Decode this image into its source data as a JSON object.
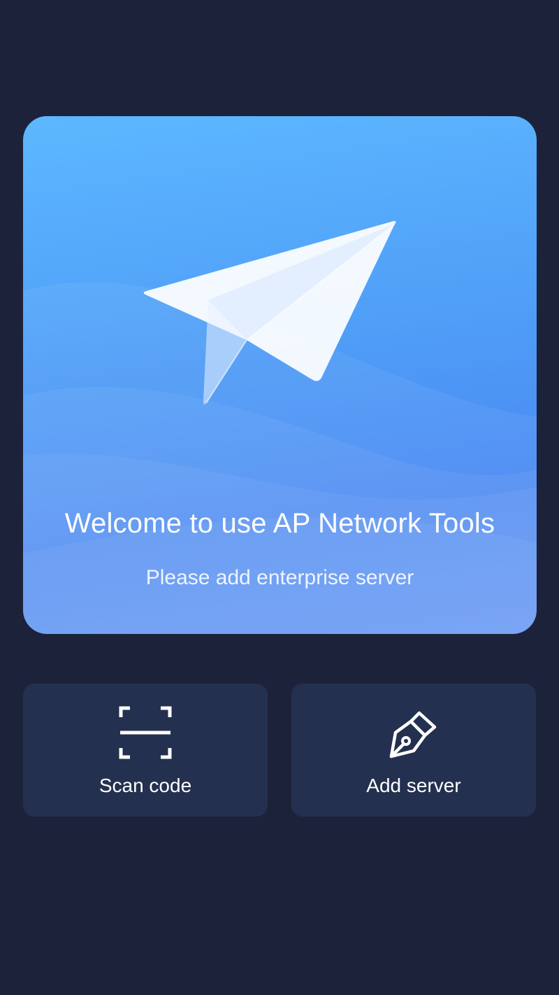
{
  "hero": {
    "title": "Welcome to use AP Network Tools",
    "subtitle": "Please add enterprise server",
    "illustration_icon": "paper-plane-icon"
  },
  "actions": [
    {
      "label": "Scan code",
      "icon": "scan-icon"
    },
    {
      "label": "Add server",
      "icon": "pen-nib-icon"
    }
  ],
  "colors": {
    "background": "#1c2239",
    "card_gradient_top": "#5db8ff",
    "card_gradient_bottom": "#5b8ff4",
    "tile_background": "#24304f",
    "text": "#ffffff"
  }
}
